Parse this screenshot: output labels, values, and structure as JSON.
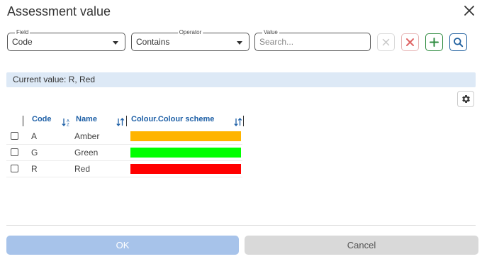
{
  "dialog": {
    "title": "Assessment value"
  },
  "filter": {
    "field_label": "Field",
    "field_value": "Code",
    "operator_label": "Operator",
    "operator_value": "Contains",
    "value_label": "Value",
    "value_placeholder": "Search..."
  },
  "toolbar_icons": [
    "close-icon",
    "clear-icon",
    "plus-icon",
    "search-icon"
  ],
  "current_value": "Current value: R, Red",
  "grid": {
    "columns": [
      "Code",
      "Name",
      "Colour.Colour scheme"
    ],
    "rows": [
      {
        "code": "A",
        "name": "Amber",
        "color": "#ffb400"
      },
      {
        "code": "G",
        "name": "Green",
        "color": "#00ff00"
      },
      {
        "code": "R",
        "name": "Red",
        "color": "#ff0000"
      }
    ]
  },
  "buttons": {
    "ok": "OK",
    "cancel": "Cancel"
  },
  "colors": {
    "accent": "#1d5fa6",
    "ok_button": "#a7c3ea",
    "add_green": "#2e8b3f",
    "remove_red": "#e06666",
    "current_bg": "#dde9f6"
  }
}
